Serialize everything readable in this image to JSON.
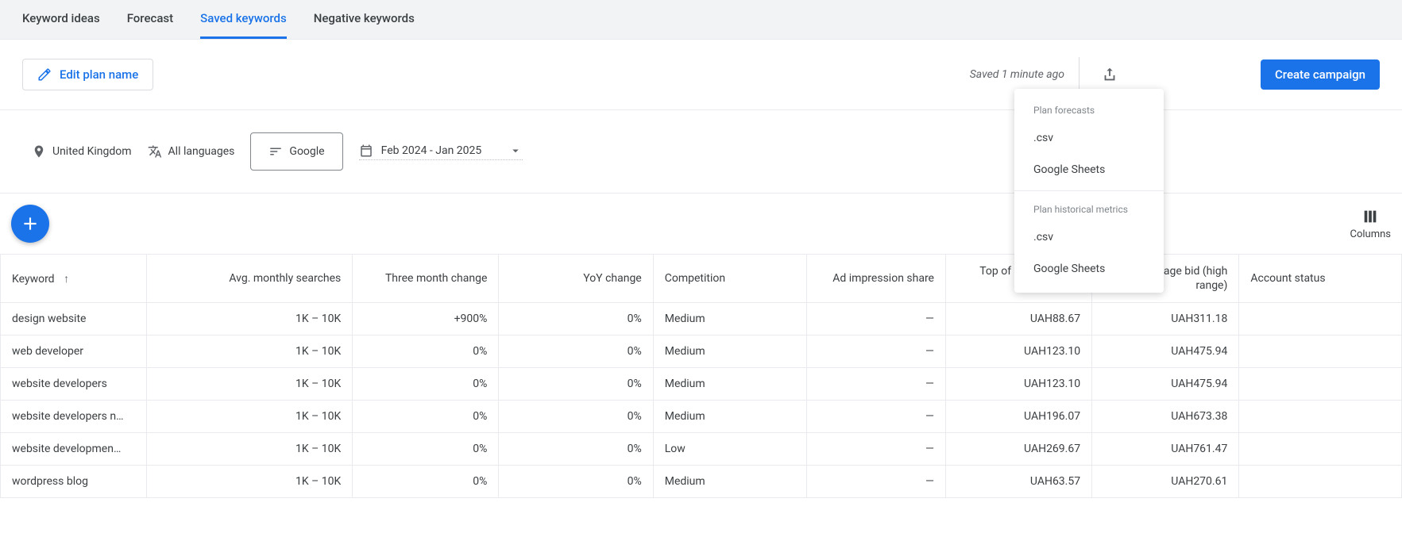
{
  "tabs": [
    "Keyword ideas",
    "Forecast",
    "Saved keywords",
    "Negative keywords"
  ],
  "active_tab_index": 2,
  "edit_plan_label": "Edit plan name",
  "saved_text": "Saved 1 minute ago",
  "create_campaign_label": "Create campaign",
  "filters": {
    "location": "United Kingdom",
    "language": "All languages",
    "network": "Google",
    "date_range": "Feb 2024 - Jan 2025"
  },
  "columns_label": "Columns",
  "export_menu": {
    "section1_header": "Plan forecasts",
    "section1_items": [
      ".csv",
      "Google Sheets"
    ],
    "section2_header": "Plan historical metrics",
    "section2_items": [
      ".csv",
      "Google Sheets"
    ]
  },
  "table": {
    "headers": {
      "keyword": "Keyword",
      "avg_searches": "Avg. monthly searches",
      "three_month": "Three month change",
      "yoy": "YoY change",
      "competition": "Competition",
      "impression": "Ad impression share",
      "bid_low": "Top of page bid (low range)",
      "bid_high": "Top of page bid (high range)",
      "status": "Account status"
    },
    "rows": [
      {
        "keyword": "design website",
        "avg": "1K – 10K",
        "tm": "+900%",
        "yoy": "0%",
        "comp": "Medium",
        "imp": "—",
        "low": "UAH88.67",
        "high": "UAH311.18"
      },
      {
        "keyword": "web developer",
        "avg": "1K – 10K",
        "tm": "0%",
        "yoy": "0%",
        "comp": "Medium",
        "imp": "—",
        "low": "UAH123.10",
        "high": "UAH475.94"
      },
      {
        "keyword": "website developers",
        "avg": "1K – 10K",
        "tm": "0%",
        "yoy": "0%",
        "comp": "Medium",
        "imp": "—",
        "low": "UAH123.10",
        "high": "UAH475.94"
      },
      {
        "keyword": "website developers n…",
        "avg": "1K – 10K",
        "tm": "0%",
        "yoy": "0%",
        "comp": "Medium",
        "imp": "—",
        "low": "UAH196.07",
        "high": "UAH673.38"
      },
      {
        "keyword": "website developmen…",
        "avg": "1K – 10K",
        "tm": "0%",
        "yoy": "0%",
        "comp": "Low",
        "imp": "—",
        "low": "UAH269.67",
        "high": "UAH761.47"
      },
      {
        "keyword": "wordpress blog",
        "avg": "1K – 10K",
        "tm": "0%",
        "yoy": "0%",
        "comp": "Medium",
        "imp": "—",
        "low": "UAH63.57",
        "high": "UAH270.61"
      }
    ]
  }
}
